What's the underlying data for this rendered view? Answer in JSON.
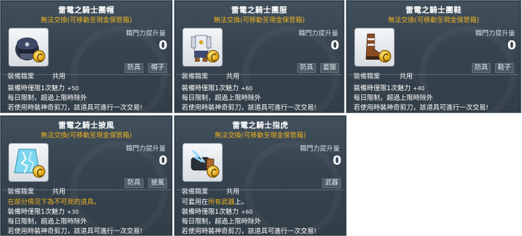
{
  "tooltips": [
    {
      "name": "雷電之騎士團帽",
      "subtitle": "無法交換(可移動至現金保管箱)",
      "attack_label": "職門力提升量",
      "attack_value": "0",
      "tag1": "防具",
      "tag2": "帽子",
      "job_label": "裝備職業",
      "job_value": "共用",
      "charm_label": "裝備時僅限1次魅力",
      "charm_value": "+50",
      "limit_text": "每日限制，超過上限時除外",
      "scissors_text": "若使用時裝神奇剪刀，該道具可進行一次交易!",
      "icon": "hat-icon"
    },
    {
      "name": "雷電之騎士團服",
      "subtitle": "無法交換(可移動至現金保管箱)",
      "attack_label": "職門力提升量",
      "attack_value": "0",
      "tag1": "防具",
      "tag2": "套服",
      "job_label": "裝備職業",
      "job_value": "共用",
      "charm_label": "裝備時僅限1次魅力",
      "charm_value": "+60",
      "limit_text": "每日限制，超過上限時除外",
      "scissors_text": "若使用時裝神奇剪刀，該道具可進行一次交易!",
      "icon": "overall-icon"
    },
    {
      "name": "雷電之騎士團鞋",
      "subtitle": "無法交換(可移動至現金保管箱)",
      "attack_label": "職門力提升量",
      "attack_value": "0",
      "tag1": "防具",
      "tag2": "鞋子",
      "job_label": "裝備職業",
      "job_value": "共用",
      "charm_label": "裝備時僅限1次魅力",
      "charm_value": "+40",
      "limit_text": "每日限制，超過上限時除外",
      "scissors_text": "若使用時裝神奇剪刀，該道具可進行一次交易!",
      "icon": "boots-icon"
    },
    {
      "name": "雷電之騎士披風",
      "subtitle": "無法交換(可移動至現金保管箱)",
      "attack_label": "職門力提升量",
      "attack_value": "0",
      "tag1": "防具",
      "tag2": "披風",
      "job_label": "裝備職業",
      "job_value": "共用",
      "note": "在部分情況下為不可見的道具。",
      "charm_label": "裝備時僅限1次魅力",
      "charm_value": "+30",
      "limit_text": "每日限制，超過上限時除外",
      "scissors_text": "若使用時裝神奇剪刀，該道具可進行一次交易!",
      "icon": "cape-icon"
    },
    {
      "name": "雷電之騎士指虎",
      "subtitle": "無法交換(可移動至現金保管箱)",
      "attack_label": "職門力提升量",
      "attack_value": "0",
      "tag1": "武器",
      "job_label": "裝備職業",
      "job_value": "共用",
      "note_prefix": "可套用在",
      "note_highlight": "所有武器",
      "note_suffix": "上。",
      "charm_label": "裝備時僅限1次魅力",
      "charm_value": "+60",
      "limit_text": "每日限制，超過上限時除外",
      "scissors_text": "若使用時裝神奇剪刀，該道具可進行一次交易!",
      "icon": "knuckle-icon"
    }
  ]
}
